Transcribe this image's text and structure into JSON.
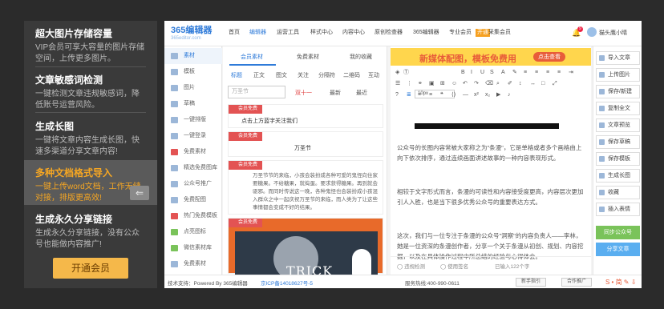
{
  "promo": {
    "items": [
      {
        "title": "超大图片存储容量",
        "desc": "VIP会员可享大容量的图片存储空间，上传更多图片。"
      },
      {
        "title": "文章敏感词检测",
        "desc": "一键检测文章违规敏感词，降低账号运营风险。"
      },
      {
        "title": "生成长图",
        "desc": "一键将文章内容生成长图，快速多渠道分享文章内容!"
      },
      {
        "title": "多种文档格式导入",
        "desc": "一键上传word文档，工作无缝对接，排版更高效!"
      },
      {
        "title": "生成永久分享链接",
        "desc": "生成永久分享链接，没有公众号也能做内容推广!"
      }
    ],
    "vip_button": "开通会员",
    "collapse_icon": "arrow-left-icon"
  },
  "app": {
    "logo": "365编辑器",
    "logo_sub": "365editor.com",
    "nav": [
      "首页",
      "编辑器",
      "运营工具",
      "样式中心",
      "内容中心",
      "原创检查器",
      "365编辑器",
      "专业会员",
      "开通",
      "采集会员"
    ],
    "nav_selected": 1,
    "notification_count": "9",
    "user": "猫头鹰小晴"
  },
  "left_nav": [
    {
      "label": "素材",
      "selected": true
    },
    {
      "label": "模板"
    },
    {
      "label": "图片"
    },
    {
      "label": "草稿"
    },
    {
      "label": "一键排版"
    },
    {
      "label": "一键登录"
    },
    {
      "label": "免费素材"
    },
    {
      "label": "精选免费图库"
    },
    {
      "label": "公众号推广"
    },
    {
      "label": "免费配图"
    },
    {
      "label": "热门免费模板"
    },
    {
      "label": "点亮图标"
    },
    {
      "label": "微信素材库"
    },
    {
      "label": "免费素材"
    }
  ],
  "materials": {
    "tabs": [
      "会员素材",
      "免费素材",
      "我的收藏"
    ],
    "categories": [
      "标题",
      "正文",
      "图文",
      "关注",
      "分隔符",
      "二维码",
      "互动"
    ],
    "search_placeholder": "万圣节",
    "filters": [
      "双十一",
      "最新",
      "最近"
    ],
    "cards": [
      {
        "badge": "会员免费",
        "text": "点击上方蓝字关注我们"
      },
      {
        "badge": "会员免费",
        "text": "万圣节"
      },
      {
        "badge": "会员免费",
        "text": "万圣节节的来临，小孩会装扮成各种可爱的鬼怪向住家要糖果。不给糖果，就捣蛋。要求获得糖果。再到就会驱邪。而同时传说这一晚，各种鬼怪也会装扮成小孩混入群众之中一起庆祝万圣节的来临，而人类为了让这些事情都会变成不好的结果。"
      },
      {
        "badge": "会员免费",
        "text": "TRICK"
      }
    ]
  },
  "editor": {
    "banner_text": "新媒体配图，模板免费用",
    "banner_button": "点击查看",
    "font_size": "10px",
    "paragraphs": [
      "公众号的长图内容常被大家称之为\"条漫\"，它是单格或者多个画格由上向下依次排序，通过连续画面讲述故事的一种内容表现形式。",
      "相较于文字形式而言，条漫的可读性和内容接受度更高，内容层次更加引人入胜，也是当下很多优秀公众号的重要表达方式。",
      "这次，我们与一位专注于条漫的公众号\"洞察\"的内容负责人——李林，她是一位资深的条漫创作者，分享一个关于条漫从初创、规划、内容挖掘，以及在具体操作过程中所总结的经验与心得体会。"
    ],
    "status": [
      "违规检测",
      "使用签名",
      "已输入122个字"
    ]
  },
  "right_panel": {
    "buttons": [
      "导入文章",
      "上传图片",
      "保存/新建",
      "复制全文",
      "文章预览",
      "保存草稿",
      "保存模板",
      "生成长图",
      "收藏",
      "插入表情"
    ],
    "sync": "同步公众号",
    "share": "分享文章"
  },
  "footer": {
    "support": "技术支持：Powered By 365编辑器",
    "icp": "京ICP备14018627号-5",
    "hotline": "服务热线:400-990-0611",
    "btn1": "新手指引",
    "btn2": "合作推广",
    "icons": "S • 简 ✎ ⇩"
  }
}
